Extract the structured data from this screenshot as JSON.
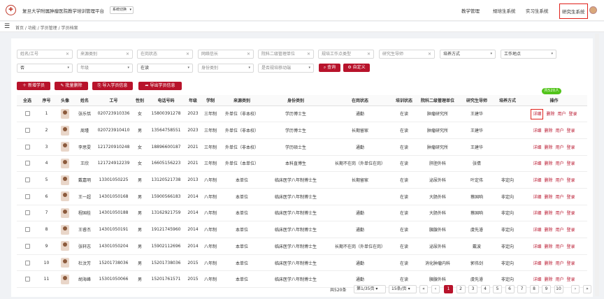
{
  "app": {
    "title": "复旦大学附属肿瘤医院教学培训管理平台",
    "system_select": "系统切换"
  },
  "topnav": [
    "教学管理",
    "规培生系统",
    "实习生系统",
    "研究生系统"
  ],
  "breadcrumb": "首页 / 功能 / 学员管理 / 学员档案",
  "filters": {
    "row1": [
      {
        "text": "姓名/工号",
        "kind": "clear"
      },
      {
        "text": "来源类别",
        "kind": "clear"
      },
      {
        "text": "在岗状态",
        "kind": "clear"
      },
      {
        "text": "网络信长",
        "kind": "clear"
      },
      {
        "text": "院科二级管理单位",
        "kind": "clear"
      },
      {
        "text": "规培工作点类型",
        "kind": "clear"
      },
      {
        "text": "研究生导师",
        "kind": "clear"
      },
      {
        "text": "培养方式",
        "kind": "select"
      },
      {
        "text": "工作地点",
        "kind": "select"
      }
    ],
    "row2": [
      {
        "text": "否",
        "kind": "select"
      },
      {
        "text": "年级",
        "kind": "select"
      },
      {
        "text": "在读",
        "kind": "select"
      },
      {
        "text": "身份类别",
        "kind": "select"
      },
      {
        "text": "是否规培移动端",
        "kind": "select"
      }
    ],
    "query_label": "查询",
    "custom_label": "自定义"
  },
  "actions": {
    "add": "新增学员",
    "batch_delete": "批量删除",
    "import": "导入学员信息",
    "export": "导出学员信息"
  },
  "total_badge": "共520人",
  "table": {
    "headers": [
      "全选",
      "序号",
      "头像",
      "姓名",
      "工号",
      "性别",
      "电话号码",
      "年级",
      "学制",
      "来源类别",
      "身份类别",
      "在岗状态",
      "培训状态",
      "院科二级管理单位",
      "研究生导师",
      "培养方式",
      "操作"
    ],
    "rows": [
      [
        "1",
        "张乐恬",
        "020723910336",
        "女",
        "15800391278",
        "2023",
        "三年制",
        "外单位（非本校）",
        "学历博士生",
        "通勤",
        "在读",
        "肿瘤研究所",
        "王建华",
        ""
      ],
      [
        "2",
        "周瑾",
        "020723910410",
        "男",
        "13564758551",
        "2023",
        "三年制",
        "外单位（非本校）",
        "学历博士生",
        "长期留家",
        "在读",
        "肿瘤研究所",
        "王建华",
        ""
      ],
      [
        "3",
        "李思雯",
        "121720910248",
        "女",
        "18896600187",
        "2021",
        "三年制",
        "外单位（非本校）",
        "学历硕士生",
        "通勤",
        "在读",
        "肿瘤研究所",
        "王建华",
        ""
      ],
      [
        "4",
        "王欣",
        "121724912239",
        "女",
        "16605156223",
        "2021",
        "三年制",
        "外单位（本单位）",
        "本科直博生",
        "长期不在岗（外单位在岗）",
        "在读",
        "肝胆外科",
        "张倩",
        ""
      ],
      [
        "5",
        "戴嘉明",
        "13301050225",
        "男",
        "13120521738",
        "2013",
        "八年制",
        "本单位",
        "临床医学八年制博士生",
        "长期留家",
        "在读",
        "泌尿外科",
        "叶定伟",
        "非定向"
      ],
      [
        "6",
        "王一超",
        "14301050168",
        "男",
        "15900566183",
        "2014",
        "八年制",
        "本单位",
        "临床医学八年制博士生",
        "",
        "在读",
        "大肠外科",
        "蔡国响",
        "非定向"
      ],
      [
        "7",
        "程国桂",
        "14301050188",
        "男",
        "13162921759",
        "2014",
        "八年制",
        "本单位",
        "临床医学八年制博士生",
        "通勤",
        "在读",
        "大肠外科",
        "蔡国响",
        "非定向"
      ],
      [
        "8",
        "王睿杰",
        "14301050191",
        "男",
        "19121745960",
        "2014",
        "八年制",
        "本单位",
        "临床医学八年制博士生",
        "通勤",
        "在读",
        "胰腺外科",
        "虞先濬",
        "非定向"
      ],
      [
        "9",
        "张轩志",
        "14301050204",
        "男",
        "15902112696",
        "2014",
        "八年制",
        "本单位",
        "临床医学八年制博士生",
        "长期不在岗（外单位在岗）",
        "在读",
        "泌尿外科",
        "戴波",
        "非定向"
      ],
      [
        "10",
        "杜汶芳",
        "15201738036",
        "男",
        "15201738036",
        "2015",
        "八年制",
        "本单位",
        "临床医学八年制博士生",
        "通勤",
        "在读",
        "消化肿瘤内科",
        "郭伟剑",
        "非定向"
      ],
      [
        "11",
        "胡海峰",
        "15301050066",
        "男",
        "15201761571",
        "2015",
        "八年制",
        "本单位",
        "临床医学八年制博士生",
        "通勤",
        "在读",
        "胰腺外科",
        "虞先濬",
        "非定向"
      ]
    ],
    "row_actions": [
      "详细",
      "删除",
      "用户",
      "登录"
    ]
  },
  "pagination": {
    "total": "共520条",
    "page_size_select": "第1/35页",
    "per_page_select": "15条/页",
    "pages": [
      "1",
      "2",
      "3",
      "4",
      "5",
      "6",
      "7",
      "8",
      "9",
      "10"
    ],
    "current": "1",
    "first": "«",
    "prev": "‹",
    "next": "›",
    "last": "»"
  }
}
